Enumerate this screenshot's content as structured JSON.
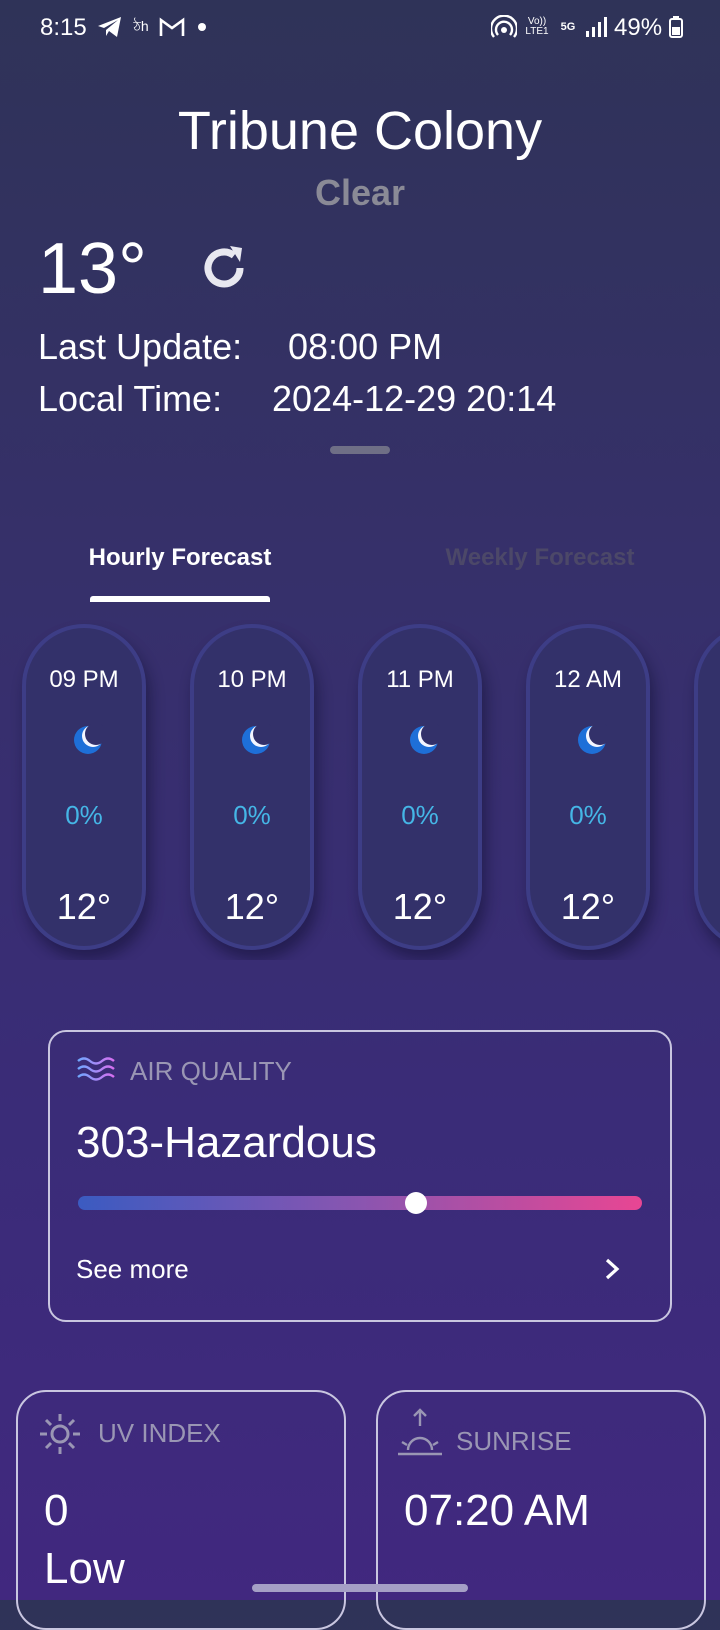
{
  "status_bar": {
    "time": "8:15",
    "battery": "49%",
    "icons": [
      "telegram-icon",
      "app-icon",
      "gmail-icon",
      "dot-icon",
      "hotspot-icon",
      "volte-icon",
      "5g-icon",
      "signal-icon",
      "battery-icon"
    ],
    "volte_label": "Vo)) LTE1",
    "network_label": "5G"
  },
  "header": {
    "location": "Tribune Colony",
    "condition": "Clear",
    "temperature": "13°",
    "last_update_label": "Last Update:",
    "last_update_value": "08:00 PM",
    "local_time_label": "Local Time:",
    "local_time_value": "2024-12-29 20:14"
  },
  "tabs": [
    {
      "label": "Hourly Forecast",
      "active": true
    },
    {
      "label": "Weekly Forecast",
      "active": false
    }
  ],
  "hourly": [
    {
      "time": "09 PM",
      "icon": "moon-icon",
      "precip": "0%",
      "temp": "12°"
    },
    {
      "time": "10 PM",
      "icon": "moon-icon",
      "precip": "0%",
      "temp": "12°"
    },
    {
      "time": "11 PM",
      "icon": "moon-icon",
      "precip": "0%",
      "temp": "12°"
    },
    {
      "time": "12 AM",
      "icon": "moon-icon",
      "precip": "0%",
      "temp": "12°"
    }
  ],
  "air_quality": {
    "title": "AIR QUALITY",
    "value": "303-Hazardous",
    "level_fraction": 0.6,
    "see_more": "See more"
  },
  "uv_index": {
    "title": "UV INDEX",
    "value": "0",
    "level": "Low"
  },
  "sunrise": {
    "title": "SUNRISE",
    "value": "07:20 AM"
  },
  "colors": {
    "accent_precip": "#45b6e6",
    "moon": "#1e6fd8",
    "aq_gradient_start": "#3b5bc1",
    "aq_gradient_end": "#e84693"
  }
}
